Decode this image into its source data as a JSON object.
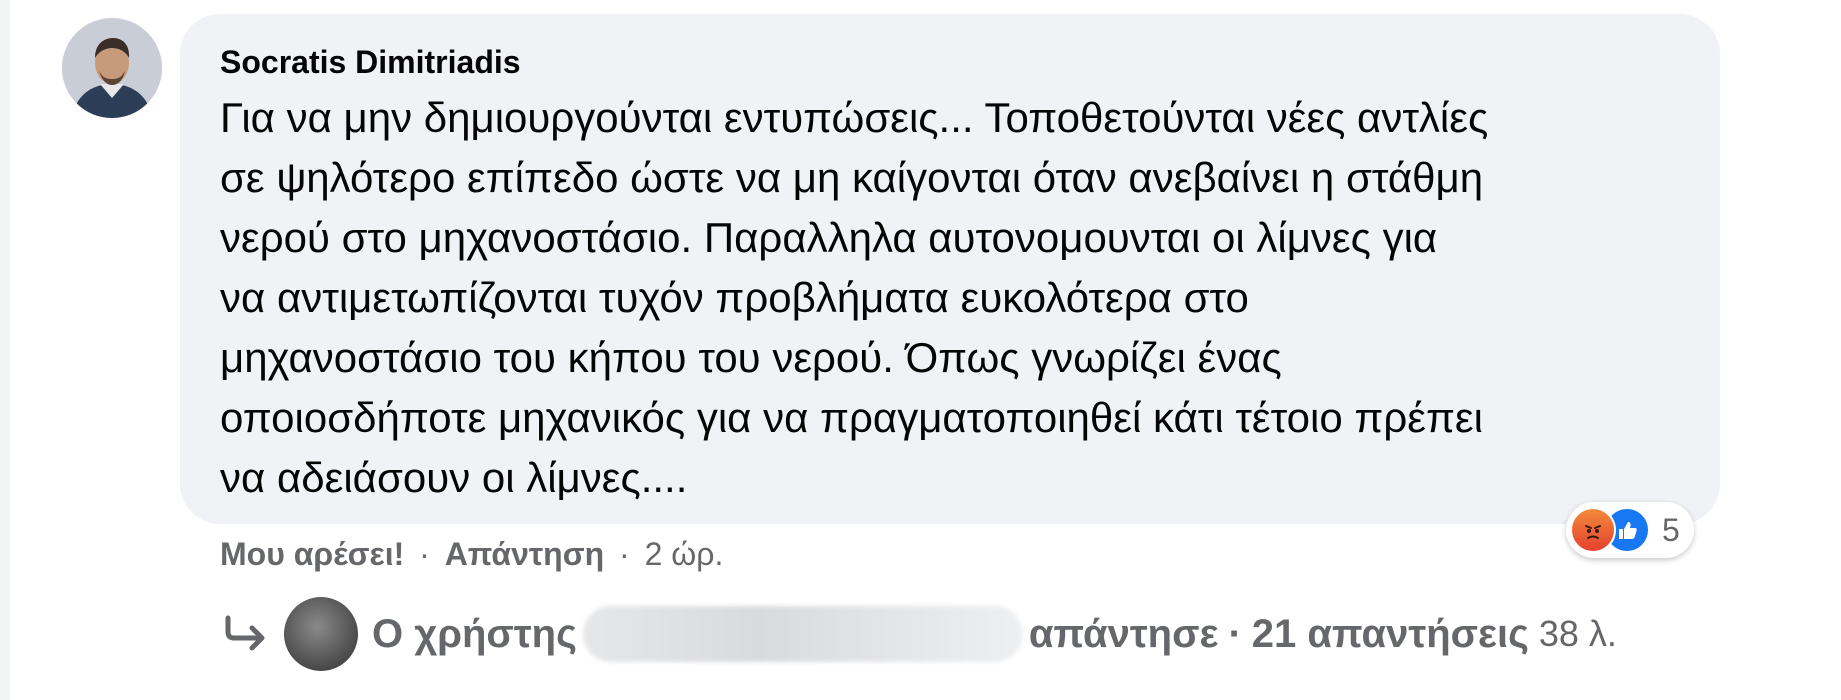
{
  "comment": {
    "author": "Socratis Dimitriadis",
    "text": "Για να μην δημιουργούνται εντυπώσεις... Τοποθετούνται νέες αντλίες\nσε ψηλότερο επίπεδο ώστε να μη καίγονται όταν ανεβαίνει η στάθμη\nνερού στο μηχανοστάσιο. Παραλληλα αυτονομουνται οι λίμνες για\nνα αντιμετωπίζονται τυχόν προβλήματα ευκολότερα στο\nμηχανοστάσιο του κήπου του νερού. Όπως γνωρίζει ένας\nοποιοσδήποτε μηχανικός για να πραγματοποιηθεί κάτι τέτοιο πρέπει\nνα αδειάσουν οι λίμνες...."
  },
  "reactions": {
    "icons": [
      "angry-icon",
      "like-icon"
    ],
    "count": "5",
    "colors": {
      "angry": "#e6402f",
      "like": "#1877f2"
    }
  },
  "actions": {
    "like_label": "Μου αρέσει!",
    "separator": "·",
    "reply_label": "Απάντηση",
    "time": "2 ώρ."
  },
  "replies": {
    "prefix": "Ο χρήστης",
    "verb": "απάντησε",
    "count_label": "21 απαντήσεις",
    "time": "38 λ."
  }
}
